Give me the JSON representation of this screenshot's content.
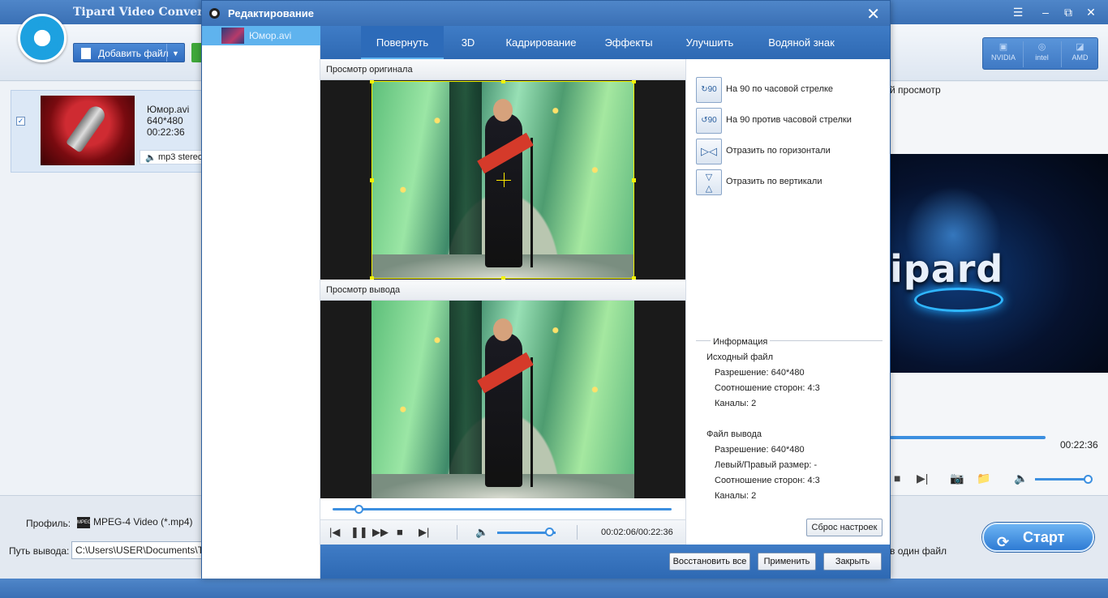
{
  "main": {
    "title": "Tipard Video Converter F",
    "add_file_label": "Добавить файл",
    "gpu": {
      "nvidia": "NVIDIA",
      "intel": "intel",
      "amd": "AMD"
    },
    "file": {
      "name": "Юмор.avi",
      "resolution": "640*480",
      "duration": "00:22:36",
      "audio": "mp3 stereo"
    },
    "preview_label": "й просмотр",
    "preview_brand": "ipard",
    "preview_time": "00:22:36",
    "profile_label": "Профиль:",
    "profile_value": "MPEG-4 Video (*.mp4)",
    "profile_icon_text": "MPEG",
    "output_label": "Путь вывода:",
    "output_path": "C:\\Users\\USER\\Documents\\Tipar",
    "merge_label": "в один файл",
    "start_label": "Старт"
  },
  "dialog": {
    "title": "Редактирование",
    "file_item": "Юмор.avi",
    "tabs": [
      "Повернуть",
      "3D",
      "Кадрирование",
      "Эффекты",
      "Улучшить",
      "Водяной знак"
    ],
    "original_label": "Просмотр оригинала",
    "output_label": "Просмотр вывода",
    "player_time": "00:02:06/00:22:36",
    "seek_progress": 0.08,
    "volume_level": 0.9,
    "rotate": {
      "cw_icon_text": "90",
      "ccw_icon_text": "90",
      "cw_label": "На 90 по часовой стрелке",
      "ccw_label": "На 90 против часовой стрелки",
      "flip_h_label": "Отразить по горизонтали",
      "flip_v_label": "Отразить по вертикали"
    },
    "info": {
      "title": "Информация",
      "source_heading": "Исходный файл",
      "source_resolution": "Разрешение: 640*480",
      "source_aspect": "Соотношение сторон: 4:3",
      "source_channels": "Каналы: 2",
      "output_heading": "Файл вывода",
      "output_resolution": "Разрешение: 640*480",
      "output_lr": "Левый/Правый размер: -",
      "output_aspect": "Соотношение сторон: 4:3",
      "output_channels": "Каналы: 2"
    },
    "reset_label": "Сброс настроек",
    "restore_all_label": "Восстановить все",
    "apply_label": "Применить",
    "close_label": "Закрыть"
  },
  "colors": {
    "accent": "#3a70b5",
    "highlight": "#5fb3ee",
    "crop_frame": "#f2f200"
  },
  "icons": [
    "logo-icon",
    "add-file-icon",
    "close-icon",
    "play-icon",
    "pause-icon",
    "volume-icon",
    "rotate-cw-icon",
    "rotate-ccw-icon",
    "flip-horizontal-icon",
    "flip-vertical-icon",
    "camera-icon",
    "folder-icon",
    "refresh-icon"
  ]
}
